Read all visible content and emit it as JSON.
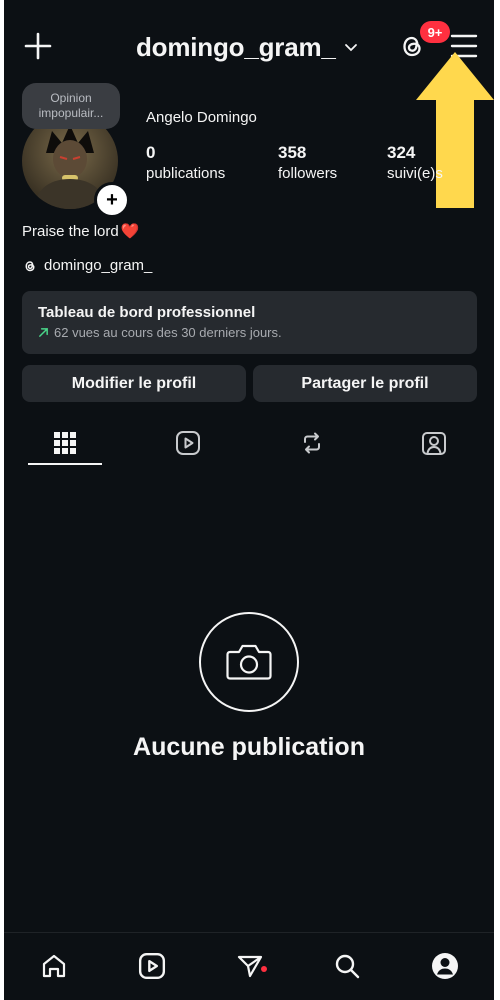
{
  "header": {
    "username": "domingo_gram_",
    "notification_badge": "9+",
    "icons": [
      "plus-icon",
      "chevron-down-icon",
      "threads-icon",
      "hamburger-menu-icon"
    ]
  },
  "profile": {
    "note_line1": "Opinion",
    "note_line2": "impopulair...",
    "full_name": "Angelo Domingo",
    "stats": {
      "posts_count": "0",
      "posts_label": "publications",
      "followers_count": "358",
      "followers_label": "followers",
      "following_count": "324",
      "following_label": "suivi(e)s"
    },
    "bio": "Praise the lord",
    "bio_emoji": "❤️",
    "threads_handle": "domingo_gram_"
  },
  "dashboard": {
    "title": "Tableau de bord professionnel",
    "subtitle": "62 vues au cours des 30 derniers jours."
  },
  "actions": {
    "edit_profile": "Modifier le profil",
    "share_profile": "Partager le profil"
  },
  "tabs": [
    "grid-icon",
    "reels-icon",
    "reposts-icon",
    "tagged-icon"
  ],
  "empty_state": {
    "text": "Aucune publication"
  },
  "bottom_nav": [
    "home-icon",
    "reels-icon",
    "messages-icon",
    "search-icon",
    "profile-icon"
  ],
  "colors": {
    "background": "#0c1014",
    "surface": "#262a2f",
    "badge": "#ff3040",
    "arrow": "#ffd84d",
    "trend_green": "#4ad68a"
  }
}
